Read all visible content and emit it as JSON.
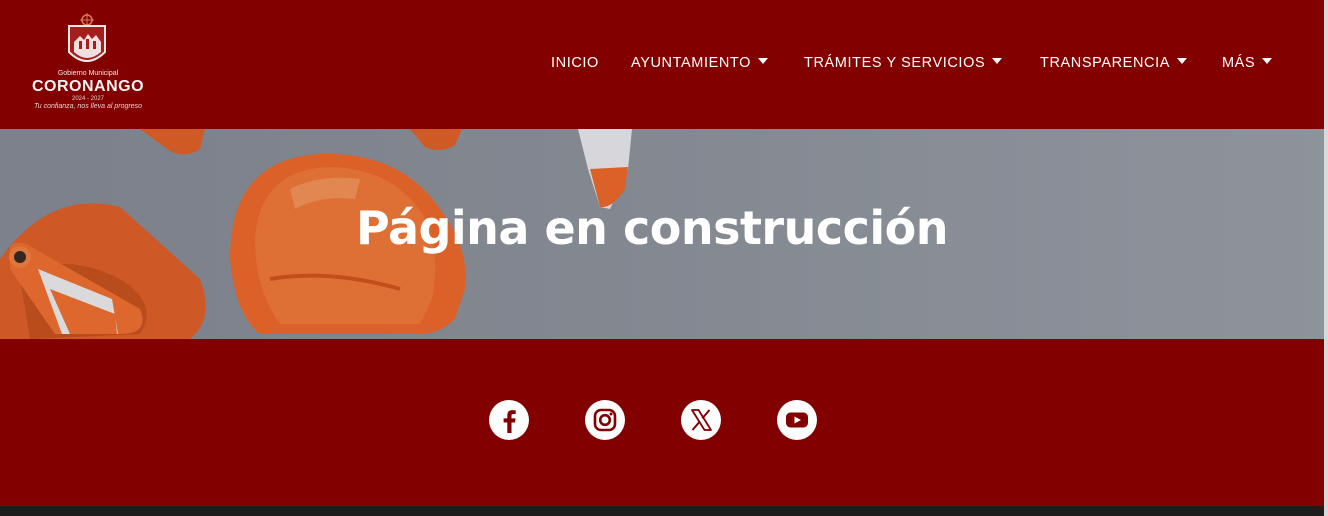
{
  "logo": {
    "line1": "Gobierno Municipal",
    "line2": "CORONANGO",
    "line3": "2024 - 2027",
    "line4": "Tu confianza, nos lleva al progreso"
  },
  "nav": {
    "items": [
      {
        "label": "INICIO",
        "has_dropdown": false
      },
      {
        "label": "AYUNTAMIENTO",
        "has_dropdown": true
      },
      {
        "label": "TRÁMITES Y SERVICIOS",
        "has_dropdown": true
      },
      {
        "label": "TRANSPARENCIA",
        "has_dropdown": true
      },
      {
        "label": "MÁS",
        "has_dropdown": true
      }
    ]
  },
  "hero": {
    "title": "Página en construcción"
  },
  "social": {
    "icons": [
      "facebook-icon",
      "instagram-icon",
      "x-icon",
      "youtube-icon"
    ]
  },
  "colors": {
    "brand": "#830000",
    "hero_bg": "#8e939d",
    "accent_orange": "#f26a2e",
    "text": "#ffffff"
  }
}
